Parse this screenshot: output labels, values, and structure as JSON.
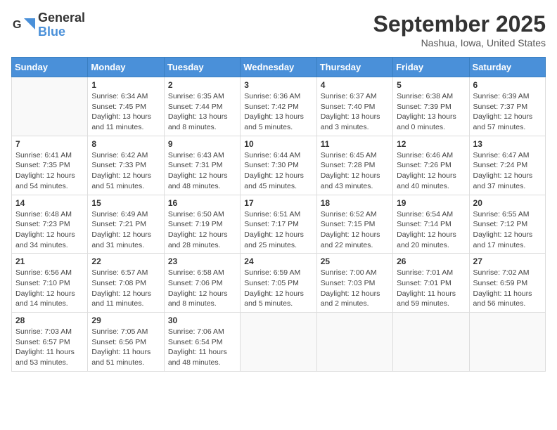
{
  "logo": {
    "general": "General",
    "blue": "Blue"
  },
  "title": "September 2025",
  "location": "Nashua, Iowa, United States",
  "days": [
    "Sunday",
    "Monday",
    "Tuesday",
    "Wednesday",
    "Thursday",
    "Friday",
    "Saturday"
  ],
  "weeks": [
    [
      {
        "num": "",
        "lines": []
      },
      {
        "num": "1",
        "lines": [
          "Sunrise: 6:34 AM",
          "Sunset: 7:45 PM",
          "Daylight: 13 hours",
          "and 11 minutes."
        ]
      },
      {
        "num": "2",
        "lines": [
          "Sunrise: 6:35 AM",
          "Sunset: 7:44 PM",
          "Daylight: 13 hours",
          "and 8 minutes."
        ]
      },
      {
        "num": "3",
        "lines": [
          "Sunrise: 6:36 AM",
          "Sunset: 7:42 PM",
          "Daylight: 13 hours",
          "and 5 minutes."
        ]
      },
      {
        "num": "4",
        "lines": [
          "Sunrise: 6:37 AM",
          "Sunset: 7:40 PM",
          "Daylight: 13 hours",
          "and 3 minutes."
        ]
      },
      {
        "num": "5",
        "lines": [
          "Sunrise: 6:38 AM",
          "Sunset: 7:39 PM",
          "Daylight: 13 hours",
          "and 0 minutes."
        ]
      },
      {
        "num": "6",
        "lines": [
          "Sunrise: 6:39 AM",
          "Sunset: 7:37 PM",
          "Daylight: 12 hours",
          "and 57 minutes."
        ]
      }
    ],
    [
      {
        "num": "7",
        "lines": [
          "Sunrise: 6:41 AM",
          "Sunset: 7:35 PM",
          "Daylight: 12 hours",
          "and 54 minutes."
        ]
      },
      {
        "num": "8",
        "lines": [
          "Sunrise: 6:42 AM",
          "Sunset: 7:33 PM",
          "Daylight: 12 hours",
          "and 51 minutes."
        ]
      },
      {
        "num": "9",
        "lines": [
          "Sunrise: 6:43 AM",
          "Sunset: 7:31 PM",
          "Daylight: 12 hours",
          "and 48 minutes."
        ]
      },
      {
        "num": "10",
        "lines": [
          "Sunrise: 6:44 AM",
          "Sunset: 7:30 PM",
          "Daylight: 12 hours",
          "and 45 minutes."
        ]
      },
      {
        "num": "11",
        "lines": [
          "Sunrise: 6:45 AM",
          "Sunset: 7:28 PM",
          "Daylight: 12 hours",
          "and 43 minutes."
        ]
      },
      {
        "num": "12",
        "lines": [
          "Sunrise: 6:46 AM",
          "Sunset: 7:26 PM",
          "Daylight: 12 hours",
          "and 40 minutes."
        ]
      },
      {
        "num": "13",
        "lines": [
          "Sunrise: 6:47 AM",
          "Sunset: 7:24 PM",
          "Daylight: 12 hours",
          "and 37 minutes."
        ]
      }
    ],
    [
      {
        "num": "14",
        "lines": [
          "Sunrise: 6:48 AM",
          "Sunset: 7:23 PM",
          "Daylight: 12 hours",
          "and 34 minutes."
        ]
      },
      {
        "num": "15",
        "lines": [
          "Sunrise: 6:49 AM",
          "Sunset: 7:21 PM",
          "Daylight: 12 hours",
          "and 31 minutes."
        ]
      },
      {
        "num": "16",
        "lines": [
          "Sunrise: 6:50 AM",
          "Sunset: 7:19 PM",
          "Daylight: 12 hours",
          "and 28 minutes."
        ]
      },
      {
        "num": "17",
        "lines": [
          "Sunrise: 6:51 AM",
          "Sunset: 7:17 PM",
          "Daylight: 12 hours",
          "and 25 minutes."
        ]
      },
      {
        "num": "18",
        "lines": [
          "Sunrise: 6:52 AM",
          "Sunset: 7:15 PM",
          "Daylight: 12 hours",
          "and 22 minutes."
        ]
      },
      {
        "num": "19",
        "lines": [
          "Sunrise: 6:54 AM",
          "Sunset: 7:14 PM",
          "Daylight: 12 hours",
          "and 20 minutes."
        ]
      },
      {
        "num": "20",
        "lines": [
          "Sunrise: 6:55 AM",
          "Sunset: 7:12 PM",
          "Daylight: 12 hours",
          "and 17 minutes."
        ]
      }
    ],
    [
      {
        "num": "21",
        "lines": [
          "Sunrise: 6:56 AM",
          "Sunset: 7:10 PM",
          "Daylight: 12 hours",
          "and 14 minutes."
        ]
      },
      {
        "num": "22",
        "lines": [
          "Sunrise: 6:57 AM",
          "Sunset: 7:08 PM",
          "Daylight: 12 hours",
          "and 11 minutes."
        ]
      },
      {
        "num": "23",
        "lines": [
          "Sunrise: 6:58 AM",
          "Sunset: 7:06 PM",
          "Daylight: 12 hours",
          "and 8 minutes."
        ]
      },
      {
        "num": "24",
        "lines": [
          "Sunrise: 6:59 AM",
          "Sunset: 7:05 PM",
          "Daylight: 12 hours",
          "and 5 minutes."
        ]
      },
      {
        "num": "25",
        "lines": [
          "Sunrise: 7:00 AM",
          "Sunset: 7:03 PM",
          "Daylight: 12 hours",
          "and 2 minutes."
        ]
      },
      {
        "num": "26",
        "lines": [
          "Sunrise: 7:01 AM",
          "Sunset: 7:01 PM",
          "Daylight: 11 hours",
          "and 59 minutes."
        ]
      },
      {
        "num": "27",
        "lines": [
          "Sunrise: 7:02 AM",
          "Sunset: 6:59 PM",
          "Daylight: 11 hours",
          "and 56 minutes."
        ]
      }
    ],
    [
      {
        "num": "28",
        "lines": [
          "Sunrise: 7:03 AM",
          "Sunset: 6:57 PM",
          "Daylight: 11 hours",
          "and 53 minutes."
        ]
      },
      {
        "num": "29",
        "lines": [
          "Sunrise: 7:05 AM",
          "Sunset: 6:56 PM",
          "Daylight: 11 hours",
          "and 51 minutes."
        ]
      },
      {
        "num": "30",
        "lines": [
          "Sunrise: 7:06 AM",
          "Sunset: 6:54 PM",
          "Daylight: 11 hours",
          "and 48 minutes."
        ]
      },
      {
        "num": "",
        "lines": []
      },
      {
        "num": "",
        "lines": []
      },
      {
        "num": "",
        "lines": []
      },
      {
        "num": "",
        "lines": []
      }
    ]
  ]
}
